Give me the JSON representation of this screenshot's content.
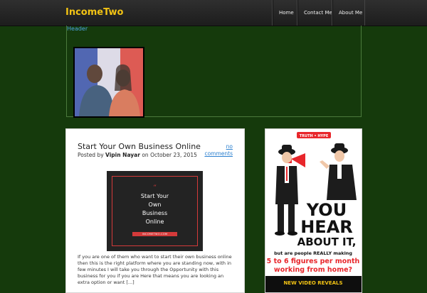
{
  "site": {
    "brand": "IncomeTwo"
  },
  "nav": {
    "items": [
      "Home",
      "Contact Me",
      "About Me"
    ]
  },
  "header": {
    "link_label": "Header"
  },
  "post": {
    "title": "Start Your Own Business Online",
    "posted_by_prefix": "Posted by",
    "author": "Vipin Nayar",
    "date_prefix": "on",
    "date": "October 23, 2015",
    "comments_link": "no comments",
    "feature": {
      "quote": "“",
      "text": "Start Your\nOwn\nBusiness\nOnline",
      "site": "INCOMETWO.COM"
    },
    "excerpt": "If you are one of them who want to start their own business online then this is the right platform where you are standing now, with in few minutes I will take you through the Opportunity with this business for you if you are Here that means you are looking an extra option or want [...]"
  },
  "ad": {
    "badge": "TRUTH • HYPE",
    "headline_1": "YOU",
    "headline_2": "HEAR",
    "headline_3": "ABOUT IT,",
    "line_1": "but are people REALLY making",
    "line_2": "5 to 6 figures per month",
    "line_3": "working from home?",
    "footer": "NEW VIDEO REVEALS"
  },
  "colors": {
    "background": "#153a0c",
    "brand": "#f2c314",
    "link": "#4aa3df",
    "accent_red": "#d43a3a"
  }
}
